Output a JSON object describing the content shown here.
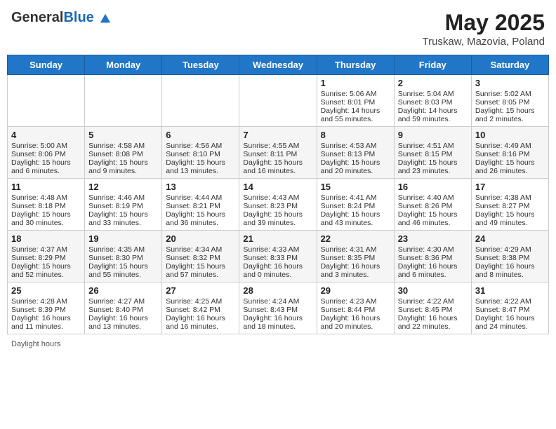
{
  "header": {
    "logo_general": "General",
    "logo_blue": "Blue",
    "title": "May 2025",
    "subtitle": "Truskaw, Mazovia, Poland"
  },
  "days_of_week": [
    "Sunday",
    "Monday",
    "Tuesday",
    "Wednesday",
    "Thursday",
    "Friday",
    "Saturday"
  ],
  "weeks": [
    [
      {
        "day": "",
        "info": ""
      },
      {
        "day": "",
        "info": ""
      },
      {
        "day": "",
        "info": ""
      },
      {
        "day": "",
        "info": ""
      },
      {
        "day": "1",
        "info": "Sunrise: 5:06 AM\nSunset: 8:01 PM\nDaylight: 14 hours and 55 minutes."
      },
      {
        "day": "2",
        "info": "Sunrise: 5:04 AM\nSunset: 8:03 PM\nDaylight: 14 hours and 59 minutes."
      },
      {
        "day": "3",
        "info": "Sunrise: 5:02 AM\nSunset: 8:05 PM\nDaylight: 15 hours and 2 minutes."
      }
    ],
    [
      {
        "day": "4",
        "info": "Sunrise: 5:00 AM\nSunset: 8:06 PM\nDaylight: 15 hours and 6 minutes."
      },
      {
        "day": "5",
        "info": "Sunrise: 4:58 AM\nSunset: 8:08 PM\nDaylight: 15 hours and 9 minutes."
      },
      {
        "day": "6",
        "info": "Sunrise: 4:56 AM\nSunset: 8:10 PM\nDaylight: 15 hours and 13 minutes."
      },
      {
        "day": "7",
        "info": "Sunrise: 4:55 AM\nSunset: 8:11 PM\nDaylight: 15 hours and 16 minutes."
      },
      {
        "day": "8",
        "info": "Sunrise: 4:53 AM\nSunset: 8:13 PM\nDaylight: 15 hours and 20 minutes."
      },
      {
        "day": "9",
        "info": "Sunrise: 4:51 AM\nSunset: 8:15 PM\nDaylight: 15 hours and 23 minutes."
      },
      {
        "day": "10",
        "info": "Sunrise: 4:49 AM\nSunset: 8:16 PM\nDaylight: 15 hours and 26 minutes."
      }
    ],
    [
      {
        "day": "11",
        "info": "Sunrise: 4:48 AM\nSunset: 8:18 PM\nDaylight: 15 hours and 30 minutes."
      },
      {
        "day": "12",
        "info": "Sunrise: 4:46 AM\nSunset: 8:19 PM\nDaylight: 15 hours and 33 minutes."
      },
      {
        "day": "13",
        "info": "Sunrise: 4:44 AM\nSunset: 8:21 PM\nDaylight: 15 hours and 36 minutes."
      },
      {
        "day": "14",
        "info": "Sunrise: 4:43 AM\nSunset: 8:23 PM\nDaylight: 15 hours and 39 minutes."
      },
      {
        "day": "15",
        "info": "Sunrise: 4:41 AM\nSunset: 8:24 PM\nDaylight: 15 hours and 43 minutes."
      },
      {
        "day": "16",
        "info": "Sunrise: 4:40 AM\nSunset: 8:26 PM\nDaylight: 15 hours and 46 minutes."
      },
      {
        "day": "17",
        "info": "Sunrise: 4:38 AM\nSunset: 8:27 PM\nDaylight: 15 hours and 49 minutes."
      }
    ],
    [
      {
        "day": "18",
        "info": "Sunrise: 4:37 AM\nSunset: 8:29 PM\nDaylight: 15 hours and 52 minutes."
      },
      {
        "day": "19",
        "info": "Sunrise: 4:35 AM\nSunset: 8:30 PM\nDaylight: 15 hours and 55 minutes."
      },
      {
        "day": "20",
        "info": "Sunrise: 4:34 AM\nSunset: 8:32 PM\nDaylight: 15 hours and 57 minutes."
      },
      {
        "day": "21",
        "info": "Sunrise: 4:33 AM\nSunset: 8:33 PM\nDaylight: 16 hours and 0 minutes."
      },
      {
        "day": "22",
        "info": "Sunrise: 4:31 AM\nSunset: 8:35 PM\nDaylight: 16 hours and 3 minutes."
      },
      {
        "day": "23",
        "info": "Sunrise: 4:30 AM\nSunset: 8:36 PM\nDaylight: 16 hours and 6 minutes."
      },
      {
        "day": "24",
        "info": "Sunrise: 4:29 AM\nSunset: 8:38 PM\nDaylight: 16 hours and 8 minutes."
      }
    ],
    [
      {
        "day": "25",
        "info": "Sunrise: 4:28 AM\nSunset: 8:39 PM\nDaylight: 16 hours and 11 minutes."
      },
      {
        "day": "26",
        "info": "Sunrise: 4:27 AM\nSunset: 8:40 PM\nDaylight: 16 hours and 13 minutes."
      },
      {
        "day": "27",
        "info": "Sunrise: 4:25 AM\nSunset: 8:42 PM\nDaylight: 16 hours and 16 minutes."
      },
      {
        "day": "28",
        "info": "Sunrise: 4:24 AM\nSunset: 8:43 PM\nDaylight: 16 hours and 18 minutes."
      },
      {
        "day": "29",
        "info": "Sunrise: 4:23 AM\nSunset: 8:44 PM\nDaylight: 16 hours and 20 minutes."
      },
      {
        "day": "30",
        "info": "Sunrise: 4:22 AM\nSunset: 8:45 PM\nDaylight: 16 hours and 22 minutes."
      },
      {
        "day": "31",
        "info": "Sunrise: 4:22 AM\nSunset: 8:47 PM\nDaylight: 16 hours and 24 minutes."
      }
    ]
  ],
  "footer": {
    "daylight_label": "Daylight hours"
  }
}
